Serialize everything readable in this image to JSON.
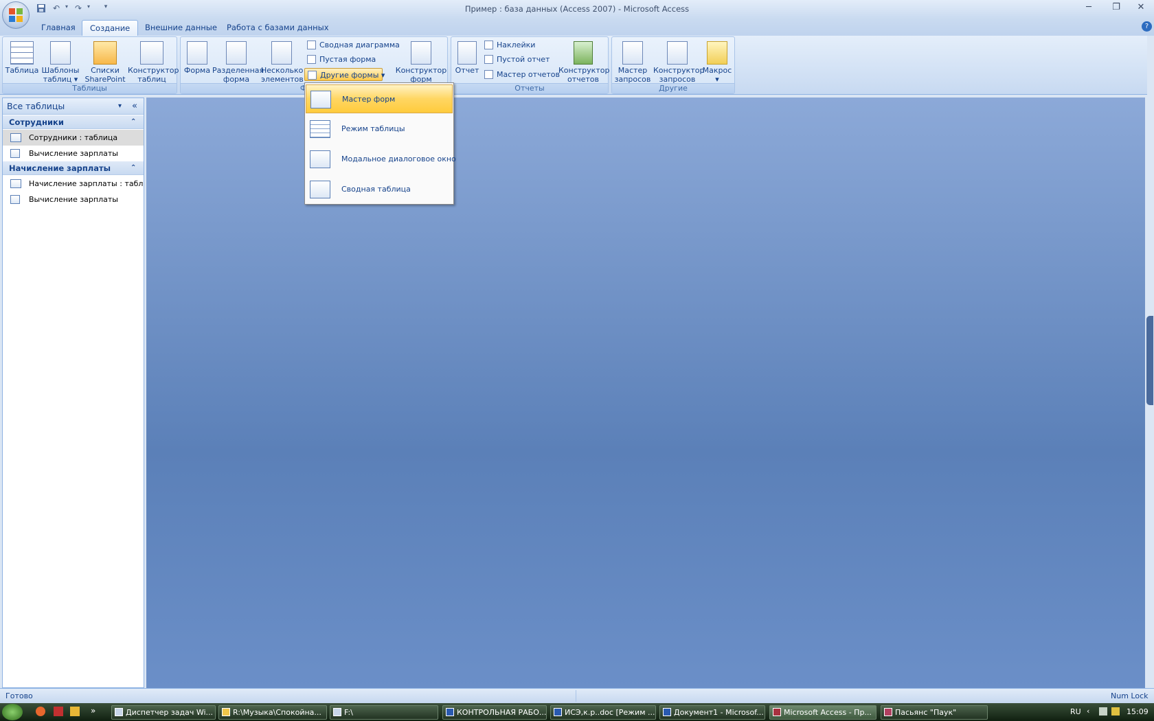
{
  "window": {
    "title": "Пример : база данных (Access 2007) - Microsoft Access",
    "minimize": "─",
    "maximize": "❐",
    "close": "✕"
  },
  "qat": {
    "save_icon": "save-icon",
    "undo_icon": "undo-icon",
    "redo_icon": "redo-icon",
    "customize_icon": "customize-icon"
  },
  "tabs": [
    "Главная",
    "Создание",
    "Внешние данные",
    "Работа с базами данных"
  ],
  "active_tab": "Создание",
  "help_icon": "?",
  "ribbon": {
    "tables": {
      "label": "Таблицы",
      "buttons": [
        {
          "line1": "Таблица",
          "line2": ""
        },
        {
          "line1": "Шаблоны",
          "line2": "таблиц ▾"
        },
        {
          "line1": "Списки",
          "line2": "SharePoint ▾"
        },
        {
          "line1": "Конструктор",
          "line2": "таблиц"
        }
      ]
    },
    "forms": {
      "label": "Формы",
      "buttons": [
        {
          "line1": "Форма",
          "line2": ""
        },
        {
          "line1": "Разделенная",
          "line2": "форма"
        },
        {
          "line1": "Несколько",
          "line2": "элементов"
        }
      ],
      "small": [
        "Сводная диаграмма",
        "Пустая форма",
        "Другие формы ▾"
      ],
      "designer": {
        "line1": "Конструктор",
        "line2": "форм"
      }
    },
    "reports": {
      "label": "Отчеты",
      "report": "Отчет",
      "small": [
        "Наклейки",
        "Пустой отчет",
        "Мастер отчетов"
      ],
      "designer": {
        "line1": "Конструктор",
        "line2": "отчетов"
      }
    },
    "other": {
      "label": "Другие",
      "buttons": [
        {
          "line1": "Мастер",
          "line2": "запросов"
        },
        {
          "line1": "Конструктор",
          "line2": "запросов"
        },
        {
          "line1": "Макрос",
          "line2": "▾"
        }
      ]
    }
  },
  "dropdown": {
    "items": [
      "Мастер форм",
      "Режим таблицы",
      "Модальное диалоговое окно",
      "Сводная таблица"
    ]
  },
  "nav": {
    "header": "Все таблицы",
    "dropdown_icon": "▾",
    "collapse_icon": "«",
    "groups": [
      {
        "name": "Сотрудники",
        "toggle": "⌃",
        "items": [
          "Сотрудники : таблица",
          "Вычисление зарплаты"
        ]
      },
      {
        "name": "Начисление зарплаты",
        "toggle": "⌃",
        "items": [
          "Начисление зарплаты : табл...",
          "Вычисление зарплаты"
        ]
      }
    ]
  },
  "status": {
    "left": "Готово",
    "right": "Num Lock"
  },
  "taskbar": {
    "quick": "»",
    "tasks": [
      "Диспетчер задач Wi...",
      "R:\\Музыка\\Спокойна...",
      "F:\\",
      "КОНТРОЛЬНАЯ РАБО...",
      "ИСЭ,к.р..doc [Режим ...",
      "Документ1 - Microsof...",
      "Microsoft Access - Пр...",
      "Пасьянс \"Паук\""
    ],
    "lang": "RU",
    "clock": "15:09"
  },
  "colors": {
    "accent": "#15428b",
    "workspace": "#6b8fc8",
    "highlight": "#ffd662"
  }
}
